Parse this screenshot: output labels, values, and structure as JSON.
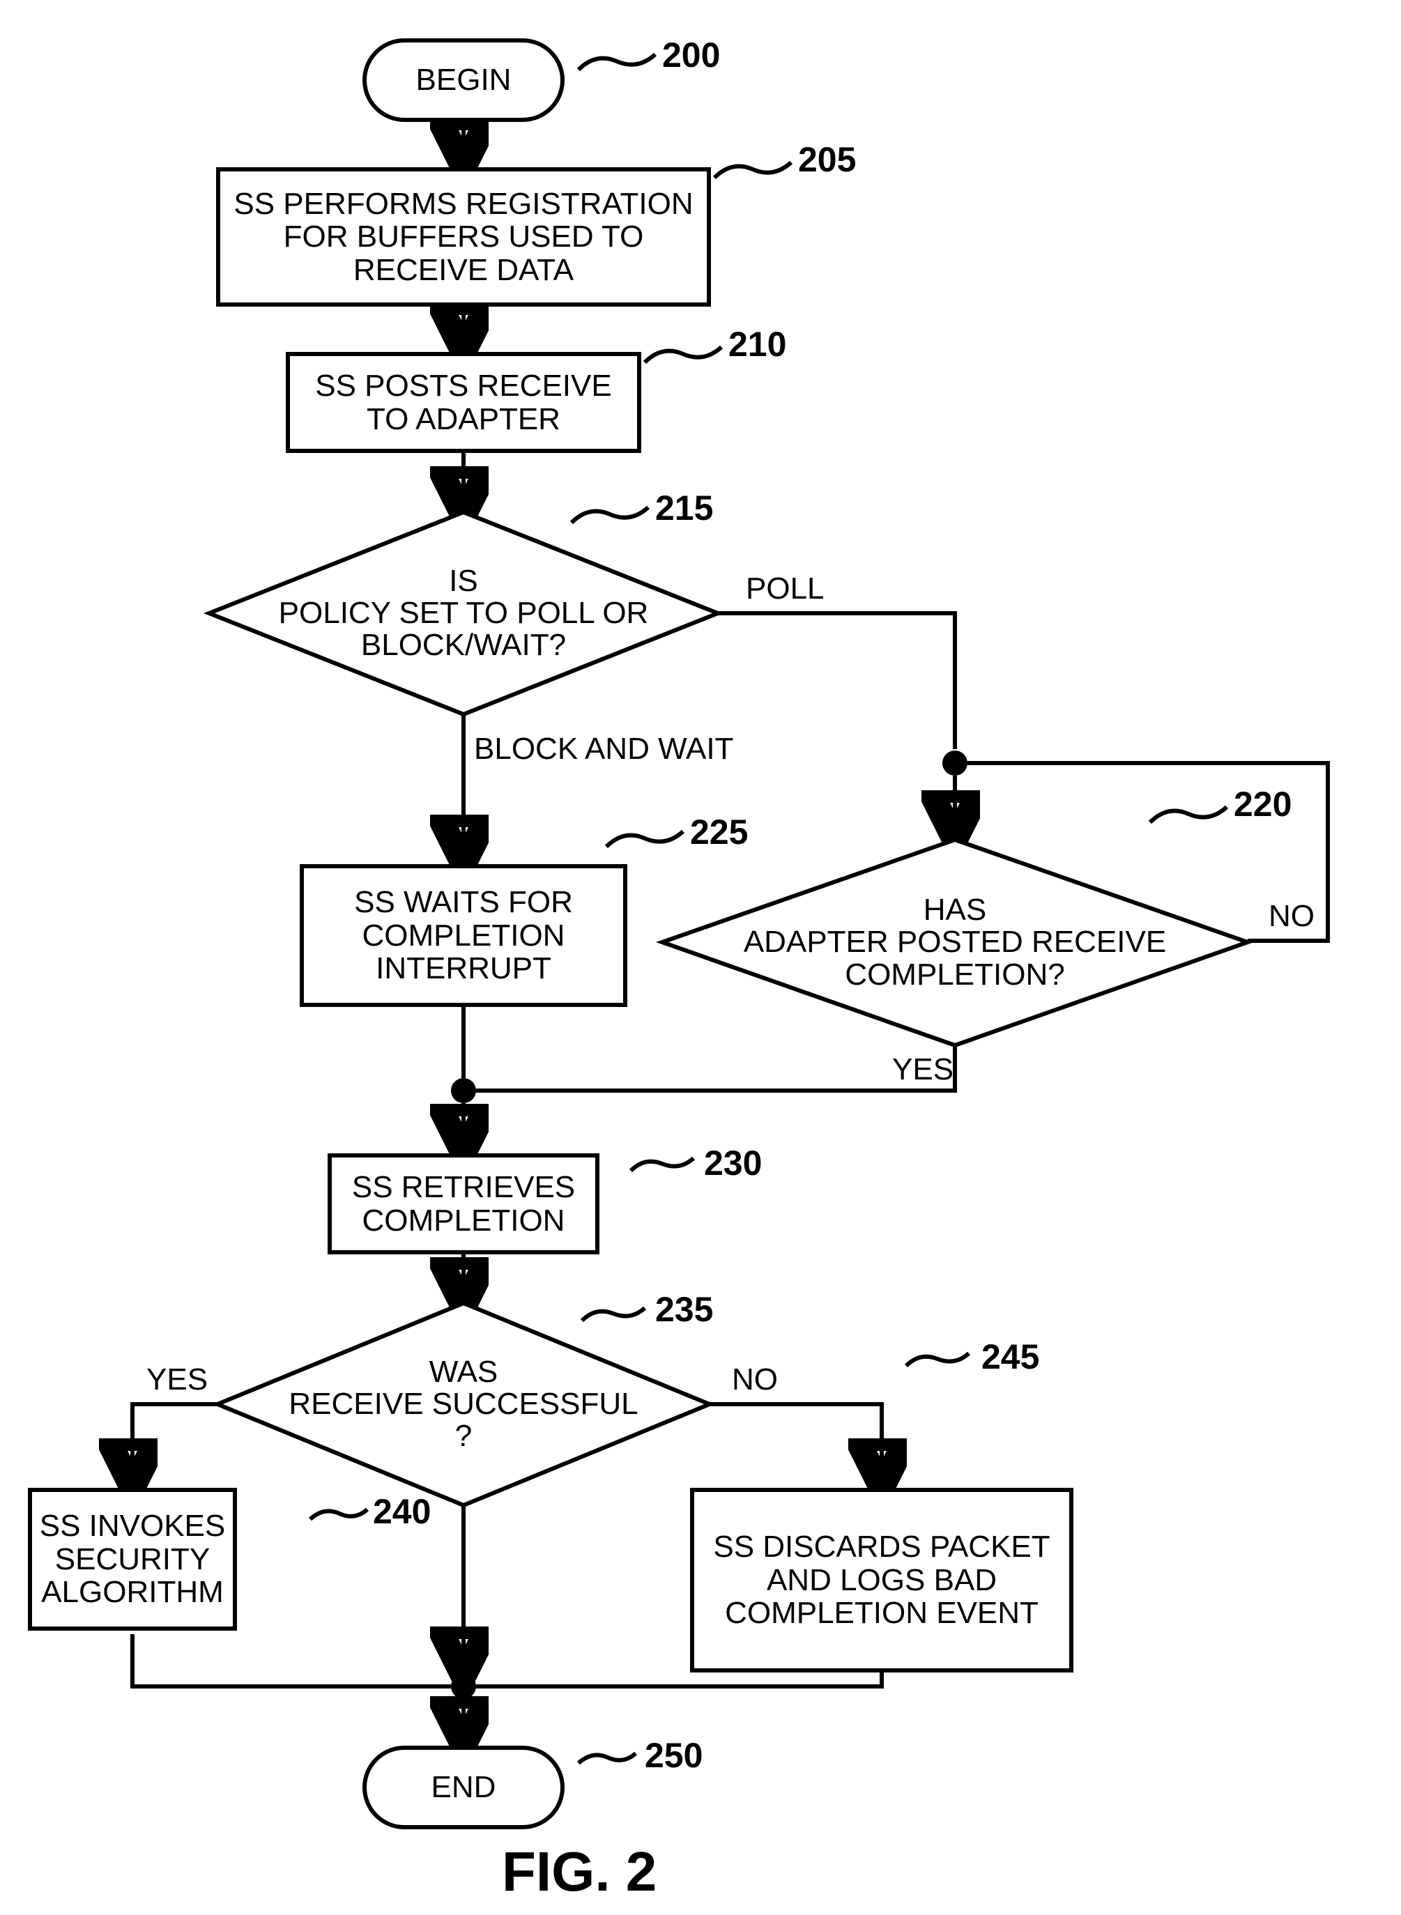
{
  "figure_label": "FIG. 2",
  "refs": {
    "n200": "200",
    "n205": "205",
    "n210": "210",
    "n215": "215",
    "n220": "220",
    "n225": "225",
    "n230": "230",
    "n235": "235",
    "n240": "240",
    "n245": "245",
    "n250": "250"
  },
  "nodes": {
    "begin": "BEGIN",
    "end": "END",
    "reg": "SS PERFORMS REGISTRATION FOR BUFFERS USED TO RECEIVE DATA",
    "post": "SS POSTS RECEIVE TO ADAPTER",
    "policy": "IS\nPOLICY SET TO POLL OR\nBLOCK/WAIT?",
    "posted": "HAS\nADAPTER POSTED RECEIVE\nCOMPLETION?",
    "wait": "SS WAITS FOR COMPLETION INTERRUPT",
    "retrieve": "SS RETRIEVES COMPLETION",
    "success": "WAS\nRECEIVE SUCCESSFUL\n?",
    "invoke": "SS INVOKES SECURITY ALGORITHM",
    "discard": "SS DISCARDS PACKET AND LOGS BAD COMPLETION EVENT"
  },
  "edge_labels": {
    "poll": "POLL",
    "blockwait": "BLOCK AND WAIT",
    "yes220": "YES",
    "no220": "NO",
    "yes235": "YES",
    "no235": "NO"
  }
}
